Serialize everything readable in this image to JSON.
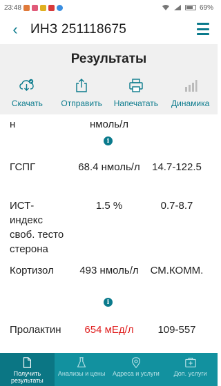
{
  "status_bar": {
    "time": "23:48",
    "battery": "69%"
  },
  "header": {
    "title": "ИНЗ 251118675"
  },
  "results": {
    "title": "Результаты"
  },
  "toolbar": {
    "download_label": "Скачать",
    "send_label": "Отправить",
    "print_label": "Напечатать",
    "dynamics_label": "Динамика"
  },
  "rows": [
    {
      "name": "н",
      "value": "нмоль/л",
      "ref": "",
      "info": true
    },
    {
      "name": "ГСПГ",
      "value": "68.4 нмоль/л",
      "ref": "14.7-122.5",
      "info": false
    },
    {
      "name": "ИСТ-индекс своб. тесто стерона",
      "value": "1.5 %",
      "ref": "0.7-8.7",
      "info": false
    },
    {
      "name": "Кортизол",
      "value": "493 нмоль/л",
      "ref": "СМ.КОММ.",
      "info": true
    },
    {
      "name": "Пролактин",
      "value": "654 мЕд/л",
      "ref": "109-557",
      "info": false
    }
  ],
  "bottom_nav": {
    "get_results": "Получить результаты",
    "tests_prices": "Анализы и цены",
    "addresses": "Адреса и услуги",
    "extra_services": "Доп. услуги"
  },
  "colors": {
    "accent": "#0a7a8c",
    "nav_bg": "#12919f",
    "alert": "#e02020"
  }
}
